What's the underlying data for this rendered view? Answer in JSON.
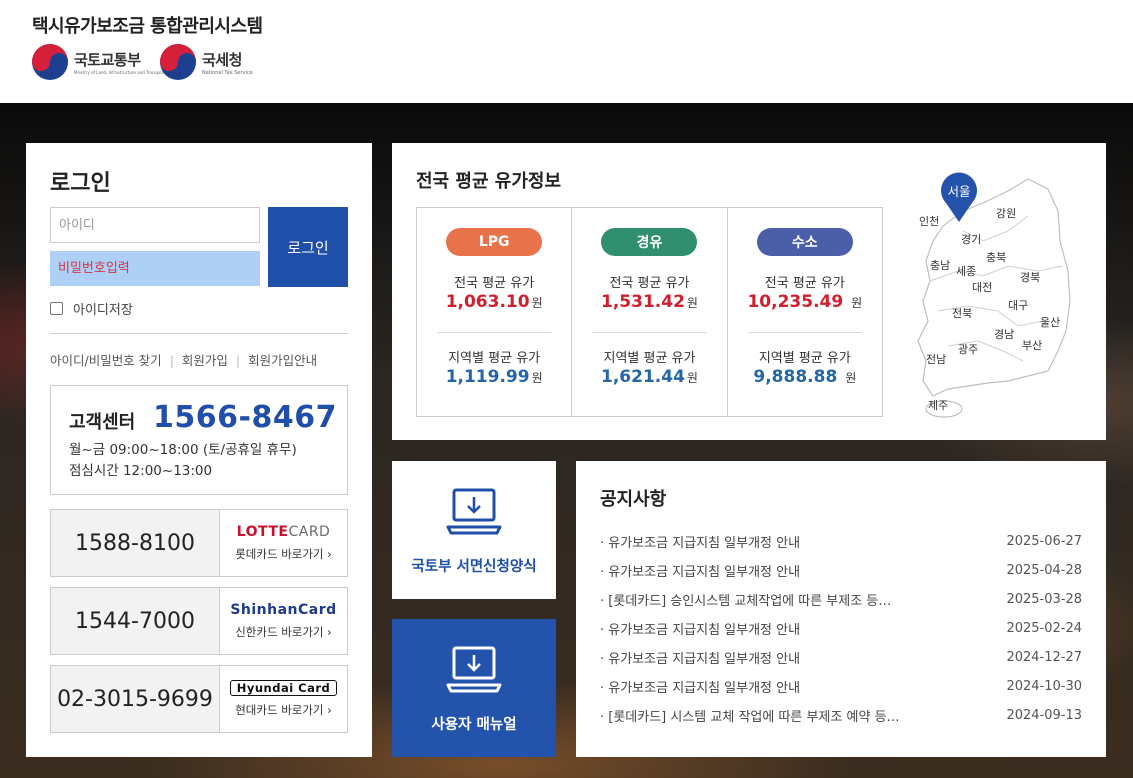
{
  "header": {
    "title": "택시유가보조금 통합관리시스템",
    "orgs": [
      {
        "name": "국토교통부",
        "sub": "Ministry of Land, Infrastructure and Transport"
      },
      {
        "name": "국세청",
        "sub": "National Tax Service"
      }
    ]
  },
  "login": {
    "title": "로그인",
    "id_placeholder": "아이디",
    "pw_placeholder": "비밀번호입력",
    "button": "로그인",
    "save_id": "아이디저장",
    "links": [
      "아이디/비밀번호 찾기",
      "회원가입",
      "회원가입안내"
    ]
  },
  "customer_center": {
    "label": "고객센터",
    "phone": "1566-8467",
    "hours": "월~금 09:00~18:00 (토/공휴일 휴무)",
    "lunch": "점심시간 12:00~13:00"
  },
  "cards": [
    {
      "phone": "1588-8100",
      "logo": "LOTTECARD",
      "logo_a": "LOTTE",
      "logo_b": "CARD",
      "link": "롯데카드 바로가기 ›"
    },
    {
      "phone": "1544-7000",
      "logo": "ShinhanCard",
      "link": "신한카드 바로가기 ›"
    },
    {
      "phone": "02-3015-9699",
      "logo": "Hyundai Card",
      "link": "현대카드 바로가기 ›"
    }
  ],
  "fuel": {
    "title": "전국 평균 유가정보",
    "national_label": "전국 평균 유가",
    "regional_label": "지역별 평균 유가",
    "unit": "원",
    "items": [
      {
        "name": "LPG",
        "color": "#e8734a",
        "national": "1,063.10",
        "regional": "1,119.99"
      },
      {
        "name": "경유",
        "color": "#2f8f6e",
        "national": "1,531.42",
        "regional": "1,621.44"
      },
      {
        "name": "수소",
        "color": "#4a5fa8",
        "national": "10,235.49",
        "regional": "9,888.88"
      }
    ],
    "map": {
      "selected": "서울",
      "regions": [
        "인천",
        "강원",
        "경기",
        "충남",
        "세종",
        "충북",
        "경북",
        "대전",
        "대구",
        "전북",
        "울산",
        "경남",
        "광주",
        "부산",
        "전남",
        "제주"
      ]
    }
  },
  "tiles": [
    {
      "label": "국토부 서면신청양식"
    },
    {
      "label": "사용자 매뉴얼"
    }
  ],
  "notice": {
    "title": "공지사항",
    "items": [
      {
        "title": "· 유가보조금 지급지침 일부개정 안내",
        "date": "2025-06-27"
      },
      {
        "title": "· 유가보조금 지급지침 일부개정 안내",
        "date": "2025-04-28"
      },
      {
        "title": "· [롯데카드] 승인시스템 교체작업에 따른 부제조 등…",
        "date": "2025-03-28"
      },
      {
        "title": "· 유가보조금 지급지침 일부개정 안내",
        "date": "2025-02-24"
      },
      {
        "title": "· 유가보조금 지급지침 일부개정 안내",
        "date": "2024-12-27"
      },
      {
        "title": "· 유가보조금 지급지침 일부개정 안내",
        "date": "2024-10-30"
      },
      {
        "title": "· [롯데카드] 시스템 교체 작업에 따른 부제조 예약 등…",
        "date": "2024-09-13"
      }
    ]
  },
  "colors": {
    "brand_blue": "#1f4fa8",
    "price_red": "#d11f2e",
    "price_blue": "#2466a8",
    "password_bg": "#aed0f5"
  }
}
